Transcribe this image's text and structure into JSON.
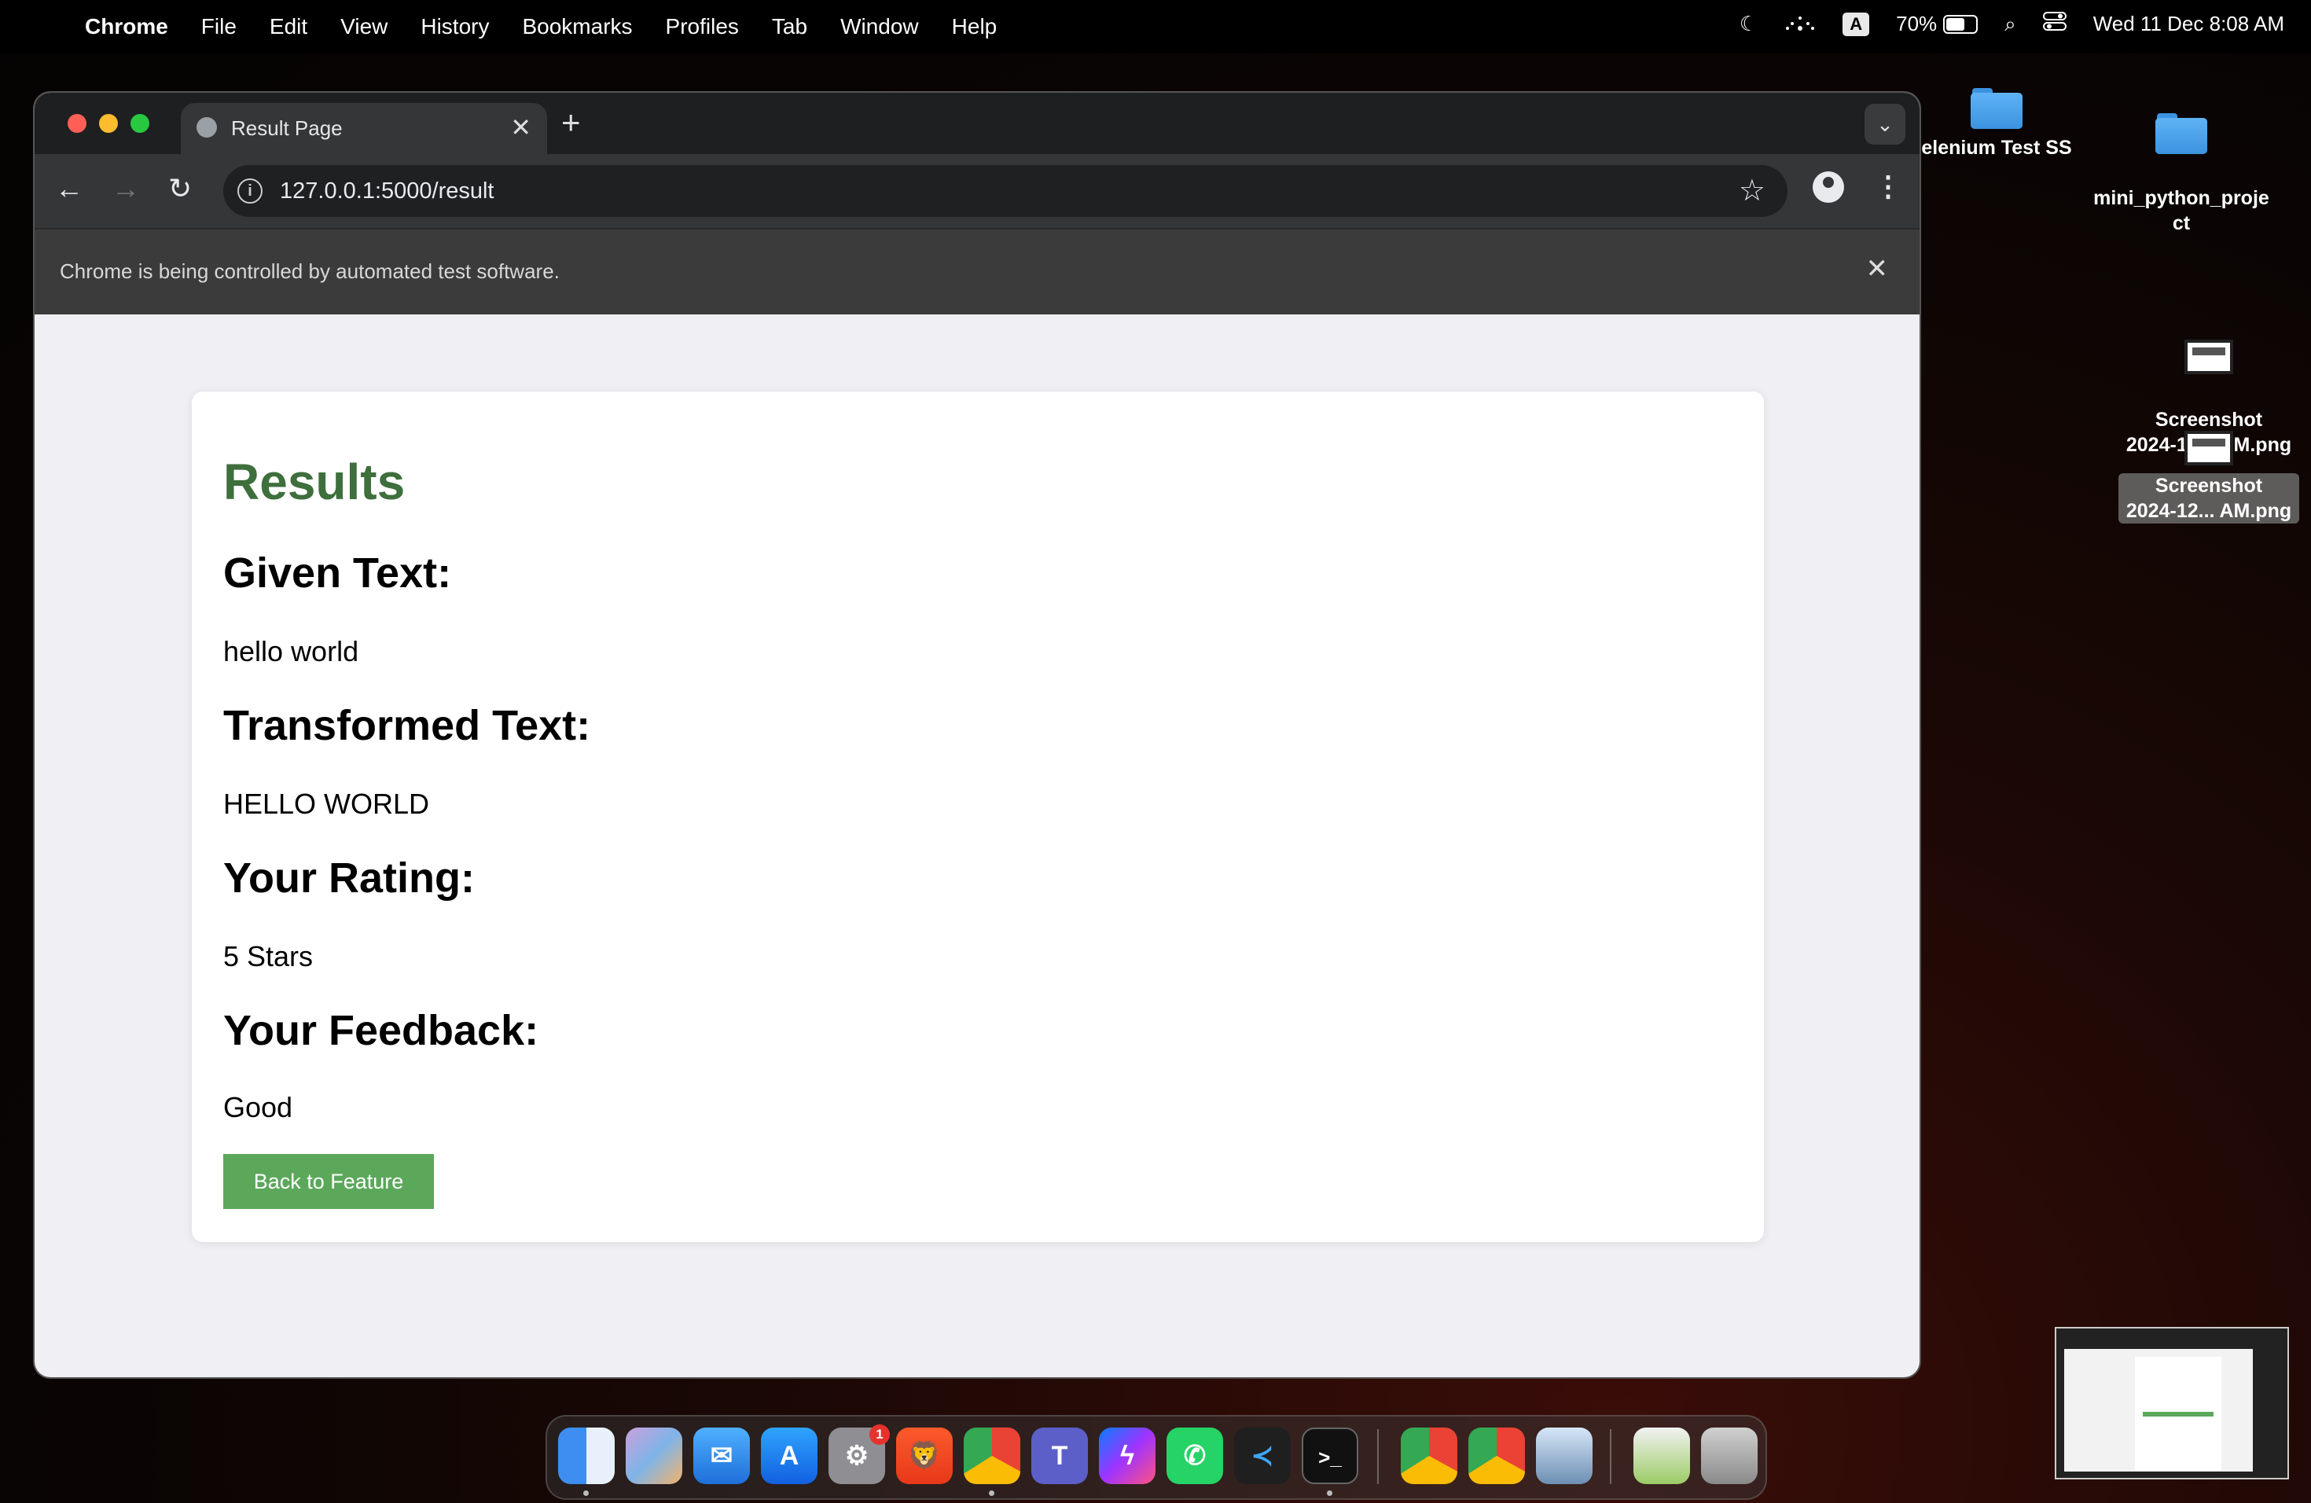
{
  "menubar": {
    "apple_glyph": "",
    "app_name": "Chrome",
    "menus": [
      "File",
      "Edit",
      "View",
      "History",
      "Bookmarks",
      "Profiles",
      "Tab",
      "Window",
      "Help"
    ],
    "moon_glyph": "☾",
    "keyboard_input": "A",
    "battery": "70%",
    "battery_level": 0.7,
    "search_glyph": "⌕",
    "clock": "Wed 11 Dec  8:08 AM"
  },
  "desktop": {
    "items": [
      {
        "label": "elenium Test SS",
        "kind": "folder"
      },
      {
        "label": "mini_python_proje\nct",
        "kind": "folder"
      },
      {
        "label": "Screenshot\n2024-12... AM.png",
        "kind": "image"
      },
      {
        "label": "Screenshot\n2024-12... AM.png",
        "kind": "image",
        "selected": true
      }
    ]
  },
  "browser": {
    "tab_title": "Result Page",
    "tab_close": "✕",
    "new_tab": "+",
    "tab_search": "⌄",
    "back": "←",
    "forward": "→",
    "reload": "↻",
    "info": "i",
    "url": "127.0.0.1:5000/result",
    "star": "☆",
    "menu": "⋮",
    "infobar_message": "Chrome is being controlled by automated test software.",
    "infobar_close": "✕"
  },
  "page": {
    "heading": "Results",
    "given_label": "Given Text:",
    "given_value": "hello world",
    "transformed_label": "Transformed Text:",
    "transformed_value": "HELLO WORLD",
    "rating_label": "Your Rating:",
    "rating_value": "5 Stars",
    "feedback_label": "Your Feedback:",
    "feedback_value": "Good",
    "back_button": "Back to Feature"
  },
  "dock": {
    "apps": [
      "finder",
      "launchpad",
      "mail",
      "app-store",
      "system-settings",
      "brave",
      "chrome",
      "teams",
      "messenger",
      "whatsapp",
      "vscode",
      "terminal",
      "chrome-2",
      "chrome-3",
      "preview",
      "mail-sender",
      "trash"
    ],
    "settings_badge": "1",
    "terminal_glyph": ">_"
  },
  "colors": {
    "accent_green": "#5ba85a",
    "heading_green": "#3e6f3c",
    "page_bg": "#efeff4"
  }
}
